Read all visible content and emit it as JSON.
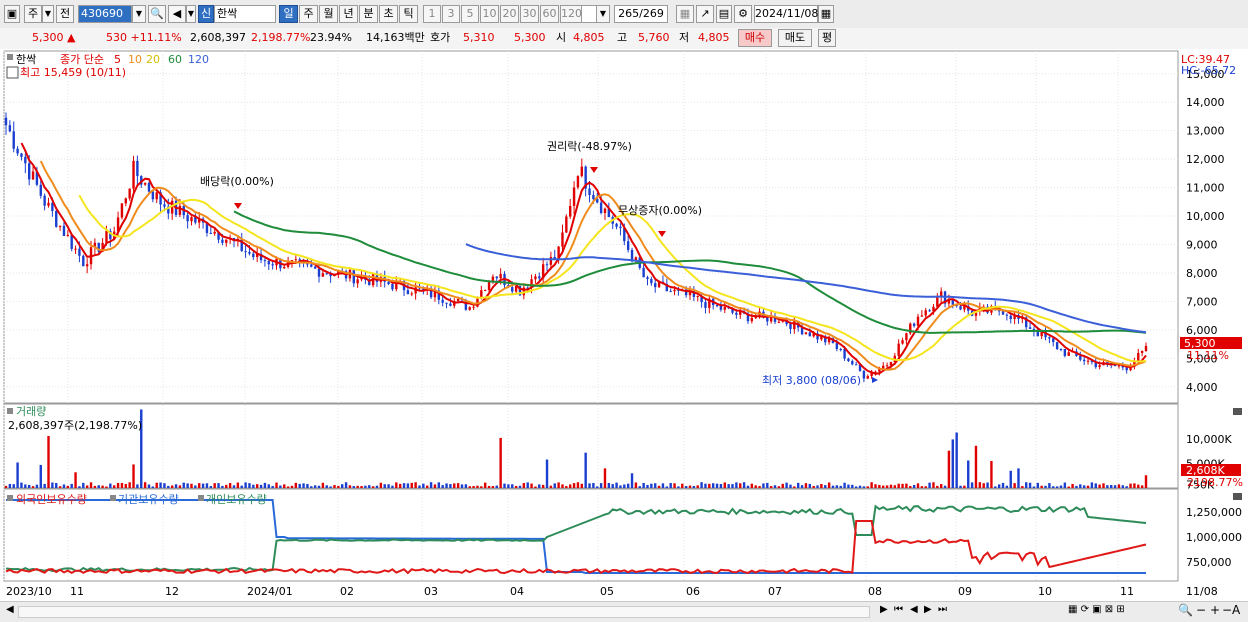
{
  "toolbar": {
    "btn_ju": "주",
    "btn_jeon": "전",
    "code": "430690",
    "btn_sin": "신",
    "name": "한싹",
    "periods": [
      "일",
      "주",
      "월",
      "년",
      "분",
      "초",
      "틱"
    ],
    "nums": [
      "1",
      "3",
      "5",
      "10",
      "20",
      "30",
      "60",
      "120"
    ],
    "count": "265",
    "total": "/269",
    "date": "2024/11/08"
  },
  "info": {
    "price": "5,300 ▲",
    "change": "530 +11.11%",
    "volume": "2,608,397",
    "vol_ratio": "2,198.77%",
    "turnover": "23.94%",
    "amount": "14,163백만",
    "ask_label": "호가",
    "ask1": "5,310",
    "ask2": "5,300",
    "open_label": "시",
    "open": "4,805",
    "high_label": "고",
    "high": "5,760",
    "low_label": "저",
    "low": "4,805",
    "buy": "매수",
    "sell": "매도",
    "eval": "평"
  },
  "colors": {
    "up": "#e00000",
    "down": "#1a3fd0",
    "ma5": "#e00000",
    "ma10": "#f08c1c",
    "ma20": "#f5e51c",
    "ma60": "#1e8c3a",
    "ma120": "#3a5fd8",
    "foreign": "#e01818",
    "inst": "#2a6ad8",
    "indiv": "#2e8c5a"
  },
  "chart_data": [
    {
      "type": "line",
      "legend": {
        "stock": "한싹",
        "label": "종가 단순",
        "periods": [
          "5",
          "10",
          "20",
          "60",
          "120"
        ]
      },
      "high_note": "최고 15,459 (10/11)",
      "low_note": "최저 3,800 (08/06)",
      "annotations": [
        "배당락(0.00%)",
        "권리락(-48.97%)",
        "무상증자(0.00%)"
      ],
      "lc": "LC:39.47",
      "hc": "HC:-65.72",
      "last_price": "5,300",
      "last_pct": "11.11%",
      "y_ticks": [
        "15,000",
        "14,000",
        "13,000",
        "12,000",
        "11,000",
        "10,000",
        "9,000",
        "8,000",
        "7,000",
        "6,000",
        "5,000",
        "4,000"
      ],
      "ylim": [
        3500,
        15800
      ],
      "x_labels": [
        "2023/10",
        "11",
        "12",
        "2024/01",
        "02",
        "03",
        "04",
        "05",
        "06",
        "07",
        "08",
        "09",
        "10",
        "11",
        "11/08"
      ],
      "close_keypoints": [
        [
          0,
          13200
        ],
        [
          10,
          10500
        ],
        [
          20,
          8400
        ],
        [
          28,
          9500
        ],
        [
          33,
          11600
        ],
        [
          40,
          10500
        ],
        [
          48,
          9900
        ],
        [
          55,
          9400
        ],
        [
          65,
          8500
        ],
        [
          85,
          8000
        ],
        [
          100,
          7600
        ],
        [
          112,
          7200
        ],
        [
          120,
          6800
        ],
        [
          126,
          8000
        ],
        [
          133,
          7400
        ],
        [
          143,
          8700
        ],
        [
          148,
          11700
        ],
        [
          152,
          10800
        ],
        [
          158,
          9600
        ],
        [
          166,
          7600
        ],
        [
          176,
          7200
        ],
        [
          190,
          6500
        ],
        [
          200,
          6400
        ],
        [
          214,
          5500
        ],
        [
          222,
          4400
        ],
        [
          228,
          4800
        ],
        [
          236,
          6500
        ],
        [
          242,
          7200
        ],
        [
          250,
          6600
        ],
        [
          258,
          6700
        ],
        [
          266,
          6000
        ],
        [
          274,
          5200
        ],
        [
          282,
          4800
        ],
        [
          290,
          4700
        ],
        [
          295,
          5300
        ]
      ]
    },
    {
      "type": "bar",
      "title": "거래량",
      "value_label": "2,608,397주(2,198.77%)",
      "y_ticks": [
        "10,000K",
        "5,000K",
        "750K"
      ],
      "last_vol": "2,608K",
      "last_pct": "2198.77%",
      "spikes": [
        [
          3,
          5200
        ],
        [
          9,
          4700
        ],
        [
          11,
          10600
        ],
        [
          18,
          3200
        ],
        [
          33,
          4800
        ],
        [
          35,
          16000
        ],
        [
          128,
          10200
        ],
        [
          140,
          5800
        ],
        [
          150,
          7200
        ],
        [
          155,
          4000
        ],
        [
          162,
          3000
        ],
        [
          244,
          7600
        ],
        [
          245,
          9900
        ],
        [
          246,
          11300
        ],
        [
          249,
          5600
        ],
        [
          251,
          8600
        ],
        [
          255,
          5500
        ],
        [
          260,
          3500
        ],
        [
          262,
          4000
        ],
        [
          295,
          2600
        ]
      ]
    },
    {
      "type": "line",
      "legend": [
        "외국인보유수량",
        "기관보유수량",
        "개인보유수량"
      ],
      "y_ticks": [
        "1,250,000",
        "1,000,000",
        "750,000"
      ]
    }
  ]
}
